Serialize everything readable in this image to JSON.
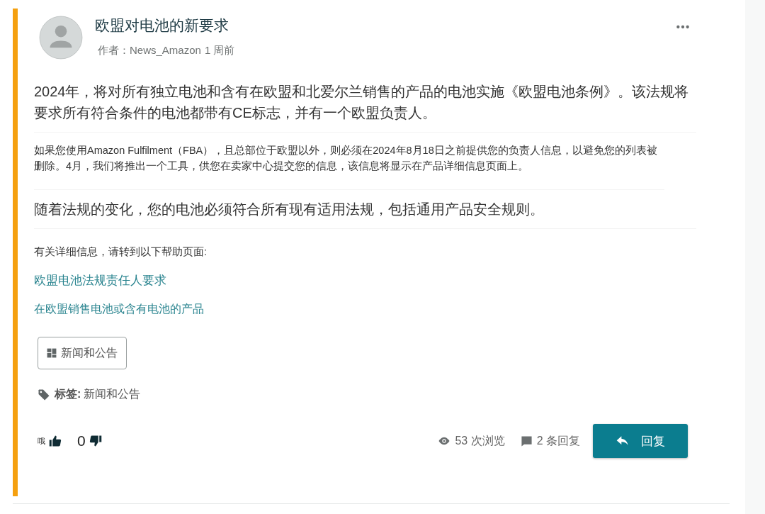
{
  "post": {
    "title": "欧盟对电池的新要求",
    "author_label": "作者：",
    "author": "News_Amazon",
    "time": "1 周前"
  },
  "body": [
    {
      "kind": "lead",
      "text": "2024年，将对所有独立电池和含有在欧盟和北爱尔兰销售的产品的电池实施《欧盟电池条例》。该法规将要求所有符合条件的电池都带有CE标志，并有一个欧盟负责人。"
    },
    {
      "kind": "small",
      "text": "如果您使用Amazon Fulfilment（FBA），且总部位于欧盟以外，则必须在2024年8月18日之前提供您的负责人信息，以避免您的列表被删除。4月，我们将推出一个工具，供您在卖家中心提交您的信息，该信息将显示在产品详细信息页面上。"
    },
    {
      "kind": "lead",
      "text": "随着法规的变化，您的电池必须符合所有现有适用法规，包括通用产品安全规则。"
    },
    {
      "kind": "note",
      "text": "有关详细信息，请转到以下帮助页面:"
    },
    {
      "kind": "link",
      "text": "欧盟电池法规责任人要求"
    },
    {
      "kind": "link-small",
      "text": "在欧盟销售电池或含有电池的产品"
    }
  ],
  "category": "新闻和公告",
  "tags": {
    "label": "标签:",
    "value": "新闻和公告"
  },
  "footer": {
    "like_label": "哦",
    "dislikes": "0",
    "views": "53 次浏览",
    "replies": "2 条回复",
    "reply_button": "回复"
  }
}
